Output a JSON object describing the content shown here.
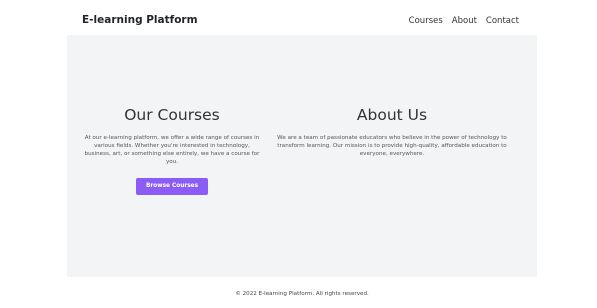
{
  "header": {
    "brand": "E-learning Platform",
    "nav": [
      "Courses",
      "About",
      "Contact"
    ]
  },
  "courses": {
    "title": "Our Courses",
    "text": "At our e-learning platform, we offer a wide range of courses in various fields. Whether you're interested in technology, business, art, or something else entirely, we have a course for you.",
    "button": "Browse Courses"
  },
  "about": {
    "title": "About Us",
    "text": "We are a team of passionate educators who believe in the power of technology to transform learning. Our mission is to provide high-quality, affordable education to everyone, everywhere."
  },
  "footer": {
    "text": "© 2022 E-learning Platform. All rights reserved."
  },
  "colors": {
    "accent": "#8b5cf6",
    "main_bg": "#f3f4f6",
    "text": "#333333"
  }
}
